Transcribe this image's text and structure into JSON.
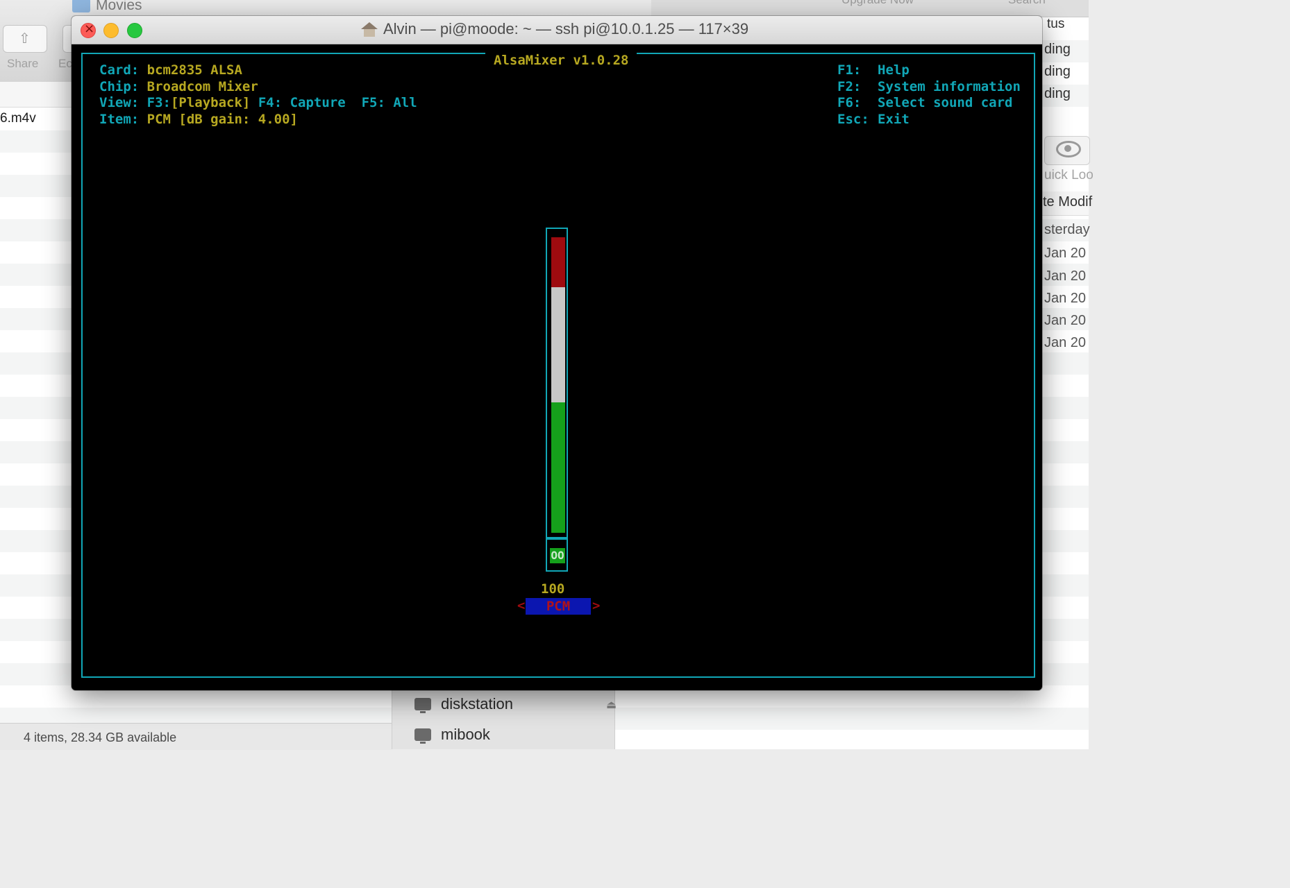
{
  "background_finder": {
    "folder_title": "Movies",
    "toolbar": {
      "share_label": "Share",
      "edit_label": "Ec"
    },
    "file_name": "6.m4v",
    "status_text": "4 items, 28.34 GB available"
  },
  "sidebar": {
    "items": [
      {
        "label": "diskstation",
        "icon": "computer-icon",
        "ejectable": true
      },
      {
        "label": "mibook",
        "icon": "computer-icon",
        "ejectable": false
      }
    ]
  },
  "background_right": {
    "top_labels": [
      "Upgrade Now",
      "Search"
    ],
    "status_header": "tus",
    "status_values": [
      "ding",
      "ding",
      "ding"
    ],
    "quick_look_label": "uick Loo",
    "date_header": "te Modif",
    "dates": [
      "sterday",
      "Jan 20",
      "Jan 20",
      "Jan 20",
      "Jan 20",
      "Jan 20"
    ]
  },
  "terminal": {
    "window_title": "Alvin — pi@moode: ~ — ssh pi@10.0.1.25 — 117×39",
    "app_title": "AlsaMixer v1.0.28",
    "info": {
      "card_label": "Card:",
      "card_value": "bcm2835 ALSA",
      "chip_label": "Chip:",
      "chip_value": "Broadcom Mixer",
      "view_label": "View:",
      "view_f3": "F3:",
      "view_f3_value": "[Playback]",
      "view_f4": "F4: Capture",
      "view_f5": "F5: All",
      "item_label": "Item:",
      "item_value": "PCM [dB gain: 4.00]"
    },
    "help": [
      {
        "key": "F1:",
        "action": "Help"
      },
      {
        "key": "F2:",
        "action": "System information"
      },
      {
        "key": "F6:",
        "action": "Select sound card"
      },
      {
        "key": "Esc:",
        "action": "Exit"
      }
    ],
    "control": {
      "volume_percent": 100,
      "volume_text": "100",
      "mute_state": "OO",
      "name": "PCM",
      "left_arrow": "<",
      "right_arrow": ">"
    }
  },
  "colors": {
    "terminal_cyan": "#11a7b7",
    "terminal_yellow": "#b7a821",
    "bar_red": "#9e0b0f",
    "bar_white": "#c7c7c7",
    "bar_green": "#15a01b",
    "selected_bg": "#0b16b0"
  }
}
